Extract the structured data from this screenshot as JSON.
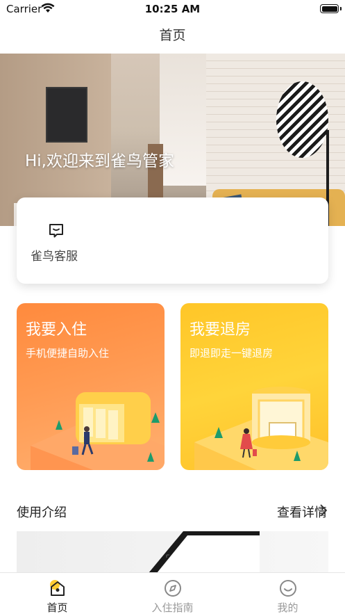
{
  "status_bar": {
    "carrier": "Carrier",
    "time": "10:25 AM"
  },
  "nav": {
    "title": "首页"
  },
  "hero": {
    "welcome": "Hi,欢迎来到雀鸟管家"
  },
  "service": {
    "label": "雀鸟客服",
    "icon": "message-icon"
  },
  "features": [
    {
      "title": "我要入住",
      "subtitle": "手机便捷自助入住",
      "color": "#ff8a3d"
    },
    {
      "title": "我要退房",
      "subtitle": "即退即走一键退房",
      "color": "#ffc628"
    }
  ],
  "intro": {
    "title": "使用介绍",
    "more": "查看详情"
  },
  "tabs": [
    {
      "label": "首页",
      "icon": "home-icon",
      "active": true
    },
    {
      "label": "入住指南",
      "icon": "compass-icon",
      "active": false
    },
    {
      "label": "我的",
      "icon": "smile-icon",
      "active": false
    }
  ],
  "colors": {
    "accent": "#ffcc33",
    "checkin": "#ff8a3d",
    "checkout": "#ffc628"
  }
}
